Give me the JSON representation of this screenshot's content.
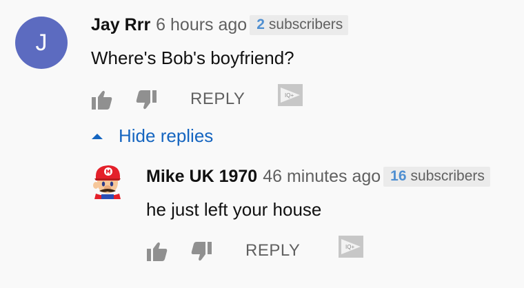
{
  "comments": [
    {
      "author": "Jay Rrr",
      "time": "6 hours ago",
      "subscriber_count": "2",
      "subscriber_label": "subscribers",
      "avatar_letter": "J",
      "text": "Where's Bob's boyfriend?",
      "reply_label": "REPLY",
      "iq_label": "IQ+"
    }
  ],
  "hide_replies_label": "Hide replies",
  "replies": [
    {
      "author": "Mike UK 1970",
      "time": "46 minutes ago",
      "subscriber_count": "16",
      "subscriber_label": "subscribers",
      "text": "he just left your house",
      "reply_label": "REPLY",
      "iq_label": "IQ+"
    }
  ],
  "colors": {
    "avatar_bg": "#5c6bc0",
    "link": "#1565c0",
    "subscriber_count": "#4f8fd1",
    "background": "#f9f9f9"
  },
  "icons": [
    "thumbs-up-icon",
    "thumbs-down-icon",
    "iq-plus-icon",
    "caret-up-icon",
    "mario-avatar"
  ]
}
